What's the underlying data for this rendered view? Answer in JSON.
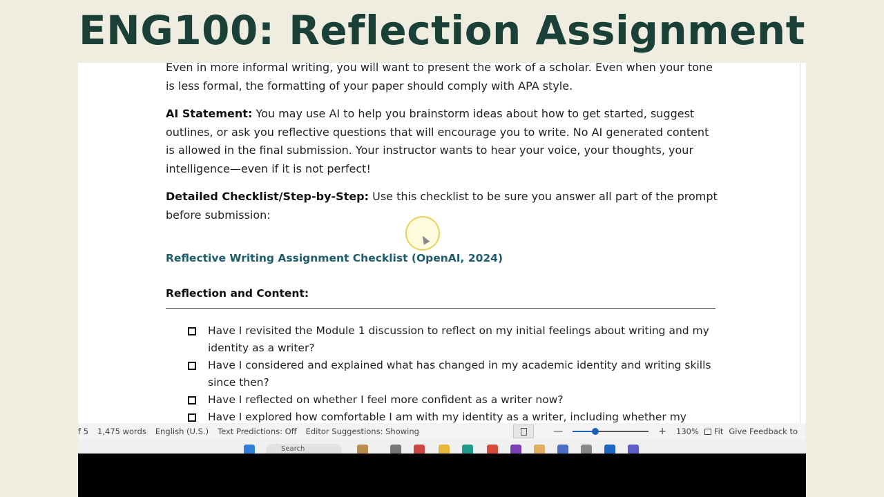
{
  "slide": {
    "title": "ENG100: Reflection Assignment"
  },
  "document": {
    "intro_tail": "Even in more informal writing, you will want to present the work of a scholar. Even when your tone is less formal, the formatting of your paper should comply with APA style.",
    "ai_statement": {
      "label": "AI Statement:",
      "text": " You may use AI to help you brainstorm ideas about how to get started, suggest outlines, or ask you reflective questions that will encourage you to write. No AI generated content is allowed in the final submission. Your instructor wants to hear your voice, your thoughts, your intelligence—even if it is not perfect!"
    },
    "checklist_intro": {
      "label": "Detailed Checklist/Step-by-Step:",
      "text": " Use this checklist to be sure you answer all part of the prompt before submission:"
    },
    "checklist_title": "Reflective Writing Assignment Checklist (OpenAI, 2024)",
    "section_heading": "Reflection and Content:",
    "checklist_items": [
      "Have I revisited the Module 1 discussion to reflect on my initial feelings about writing and my identity as a writer?",
      "Have I considered and explained what has changed in my academic identity and writing skills since then?",
      "Have I reflected on whether I feel more confident as a writer now?",
      "Have I explored how comfortable I am with my identity as a writer, including whether my"
    ]
  },
  "status_bar": {
    "page": "f 5",
    "words": "1,475 words",
    "language": "English (U.S.)",
    "text_predictions": "Text Predictions: Off",
    "editor_suggestions": "Editor Suggestions: Showing",
    "zoom_minus": "—",
    "zoom_plus": "+",
    "zoom_level": "130%",
    "fit": "Fit",
    "feedback": "Give Feedback to"
  },
  "taskbar": {
    "search_placeholder": "Search"
  },
  "colors": {
    "title": "#1b4038",
    "slide_bg": "#efece0",
    "link": "#1e5d6b",
    "zoom_accent": "#1a5fb4"
  }
}
